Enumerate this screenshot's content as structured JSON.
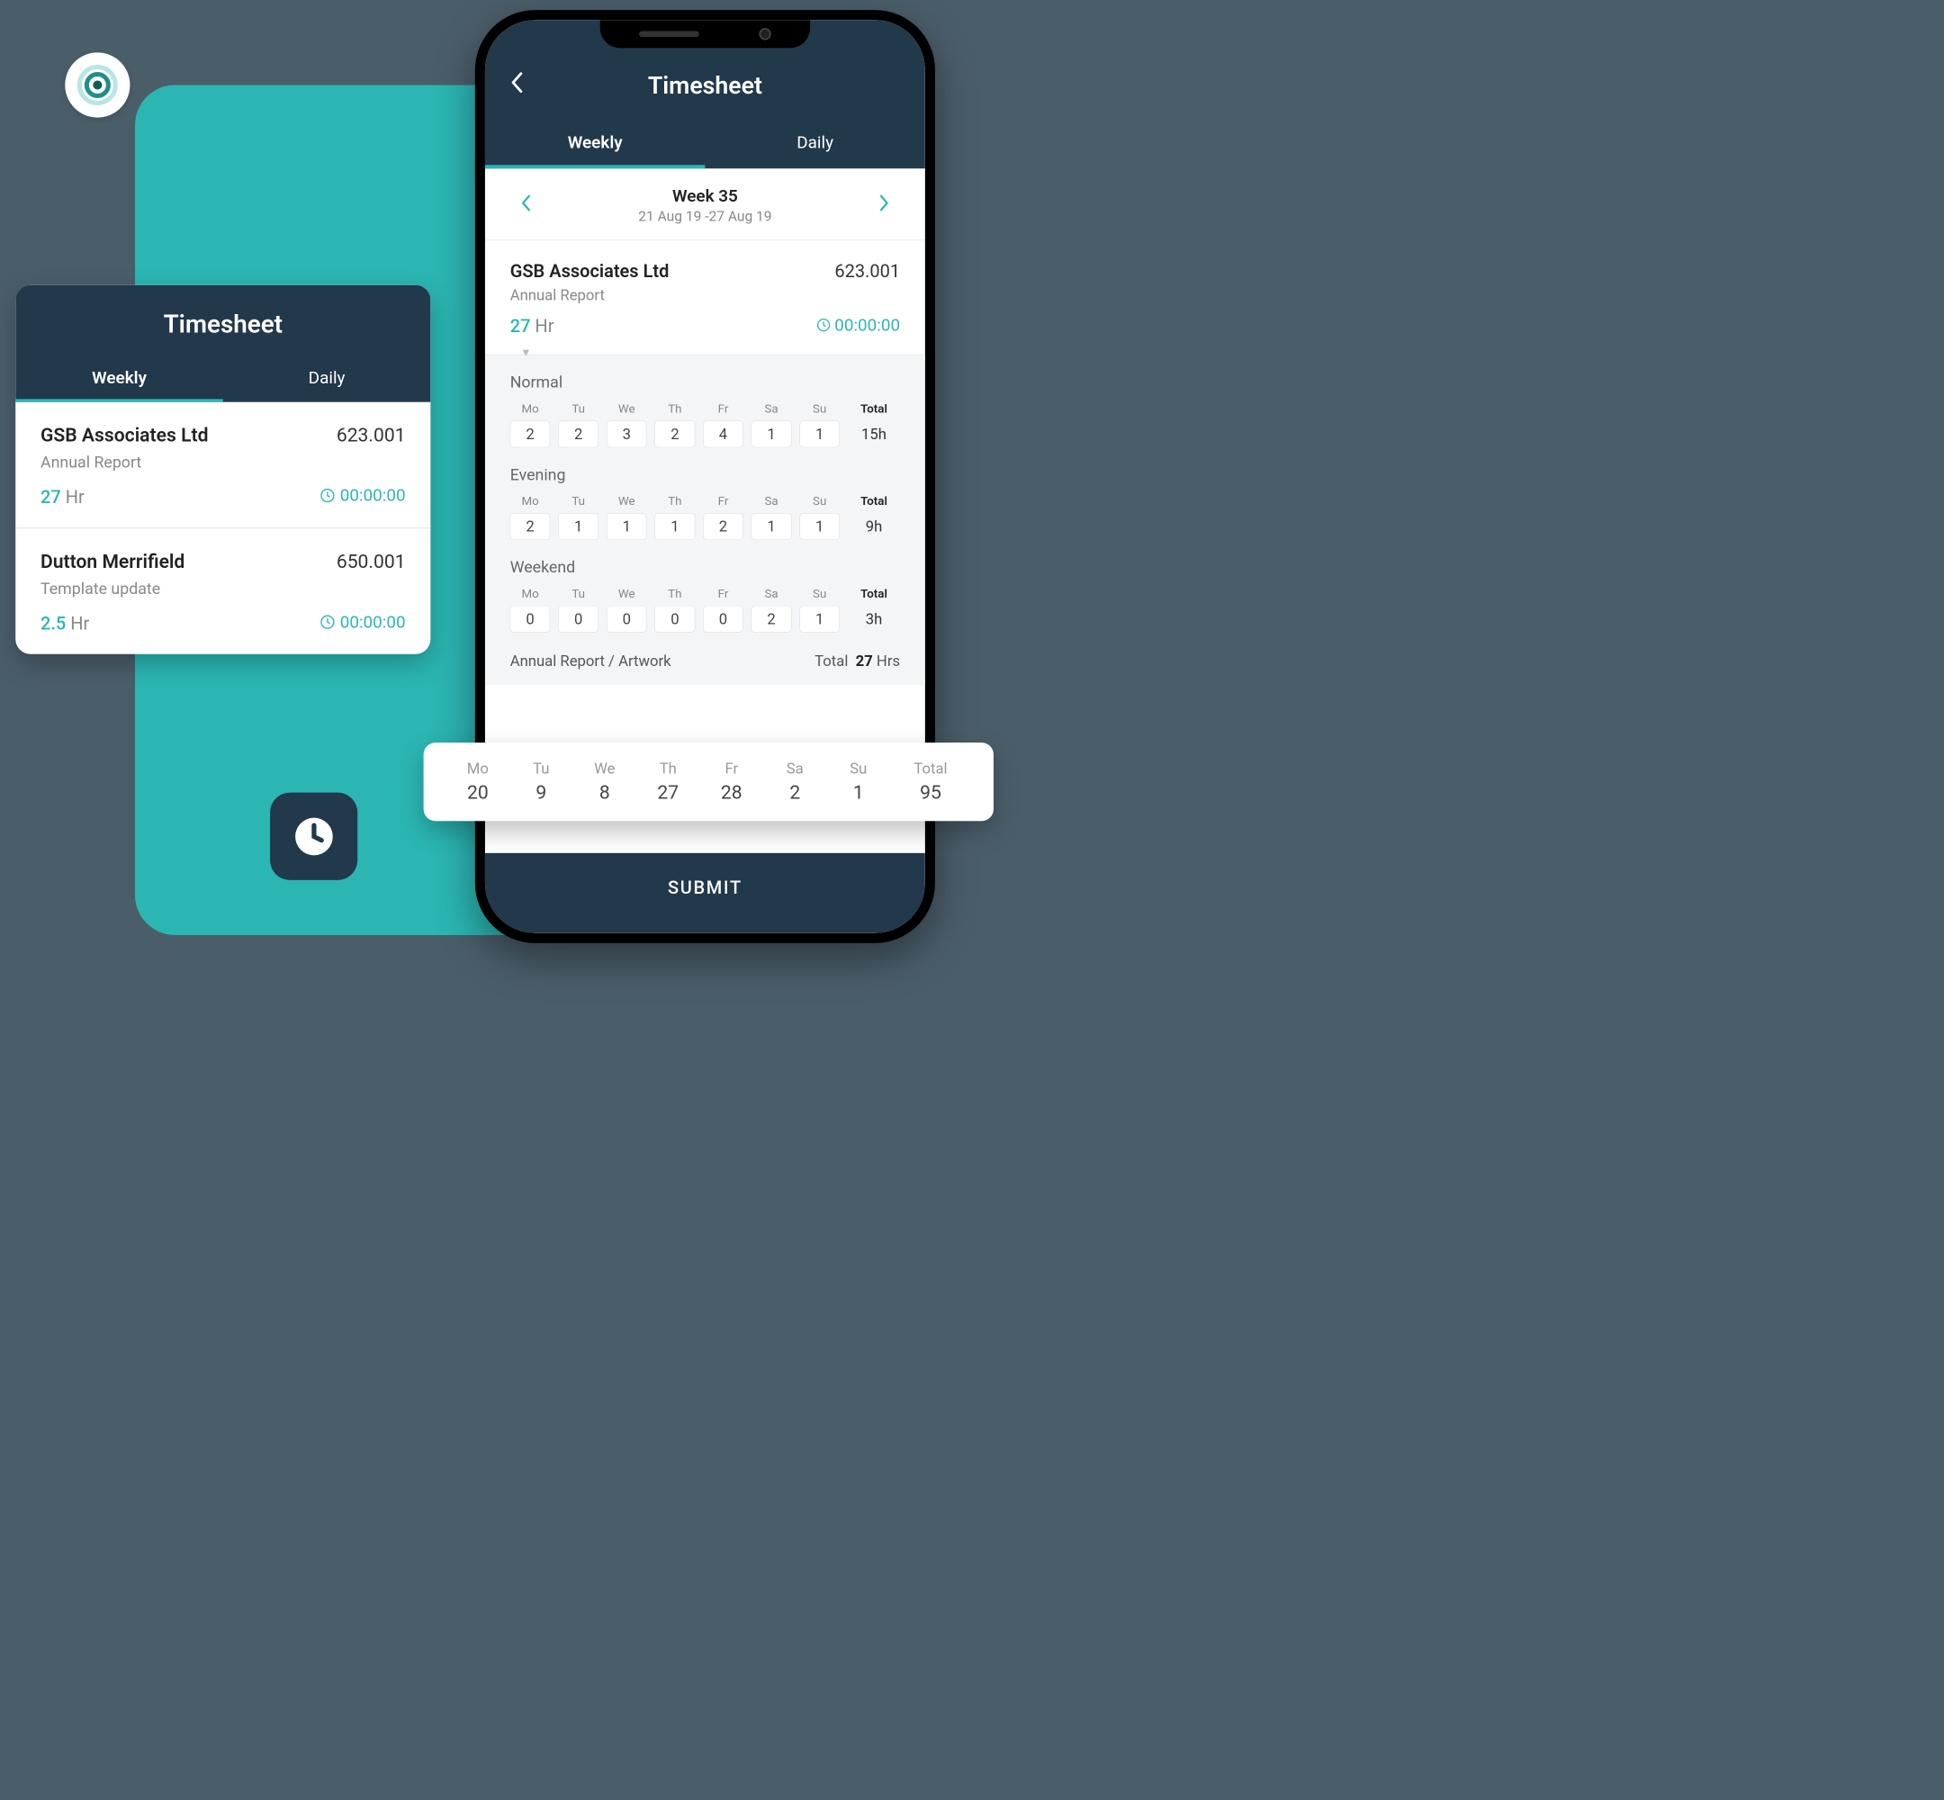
{
  "leftCard": {
    "title": "Timesheet",
    "tabs": {
      "weekly": "Weekly",
      "daily": "Daily"
    },
    "entries": [
      {
        "name": "GSB Associates Ltd",
        "code": "623.001",
        "desc": "Annual Report",
        "hours": "27",
        "hrLabel": "Hr",
        "timer": "00:00:00"
      },
      {
        "name": "Dutton Merrifield",
        "code": "650.001",
        "desc": "Template update",
        "hours": "2.5",
        "hrLabel": "Hr",
        "timer": "00:00:00"
      }
    ]
  },
  "phone": {
    "title": "Timesheet",
    "tabs": {
      "weekly": "Weekly",
      "daily": "Daily"
    },
    "weekNav": {
      "label": "Week 35",
      "range": "21 Aug 19 -27 Aug 19"
    },
    "entry": {
      "name": "GSB Associates Ltd",
      "code": "623.001",
      "desc": "Annual Report",
      "hours": "27",
      "hrLabel": "Hr",
      "timer": "00:00:00"
    },
    "days": [
      "Mo",
      "Tu",
      "We",
      "Th",
      "Fr",
      "Sa",
      "Su"
    ],
    "totalLabel": "Total",
    "sections": [
      {
        "label": "Normal",
        "values": [
          "2",
          "2",
          "3",
          "2",
          "4",
          "1",
          "1"
        ],
        "total": "15h"
      },
      {
        "label": "Evening",
        "values": [
          "2",
          "1",
          "1",
          "1",
          "2",
          "1",
          "1"
        ],
        "total": "9h"
      },
      {
        "label": "Weekend",
        "values": [
          "0",
          "0",
          "0",
          "0",
          "0",
          "2",
          "1"
        ],
        "total": "3h"
      }
    ],
    "bottom": {
      "desc": "Annual Report / Artwork",
      "totalLabel": "Total",
      "total": "27",
      "unit": "Hrs"
    },
    "submit": "SUBMIT"
  },
  "summary": {
    "days": [
      "Mo",
      "Tu",
      "We",
      "Th",
      "Fr",
      "Sa",
      "Su"
    ],
    "values": [
      "20",
      "9",
      "8",
      "27",
      "28",
      "2",
      "1"
    ],
    "totalLabel": "Total",
    "total": "95"
  }
}
